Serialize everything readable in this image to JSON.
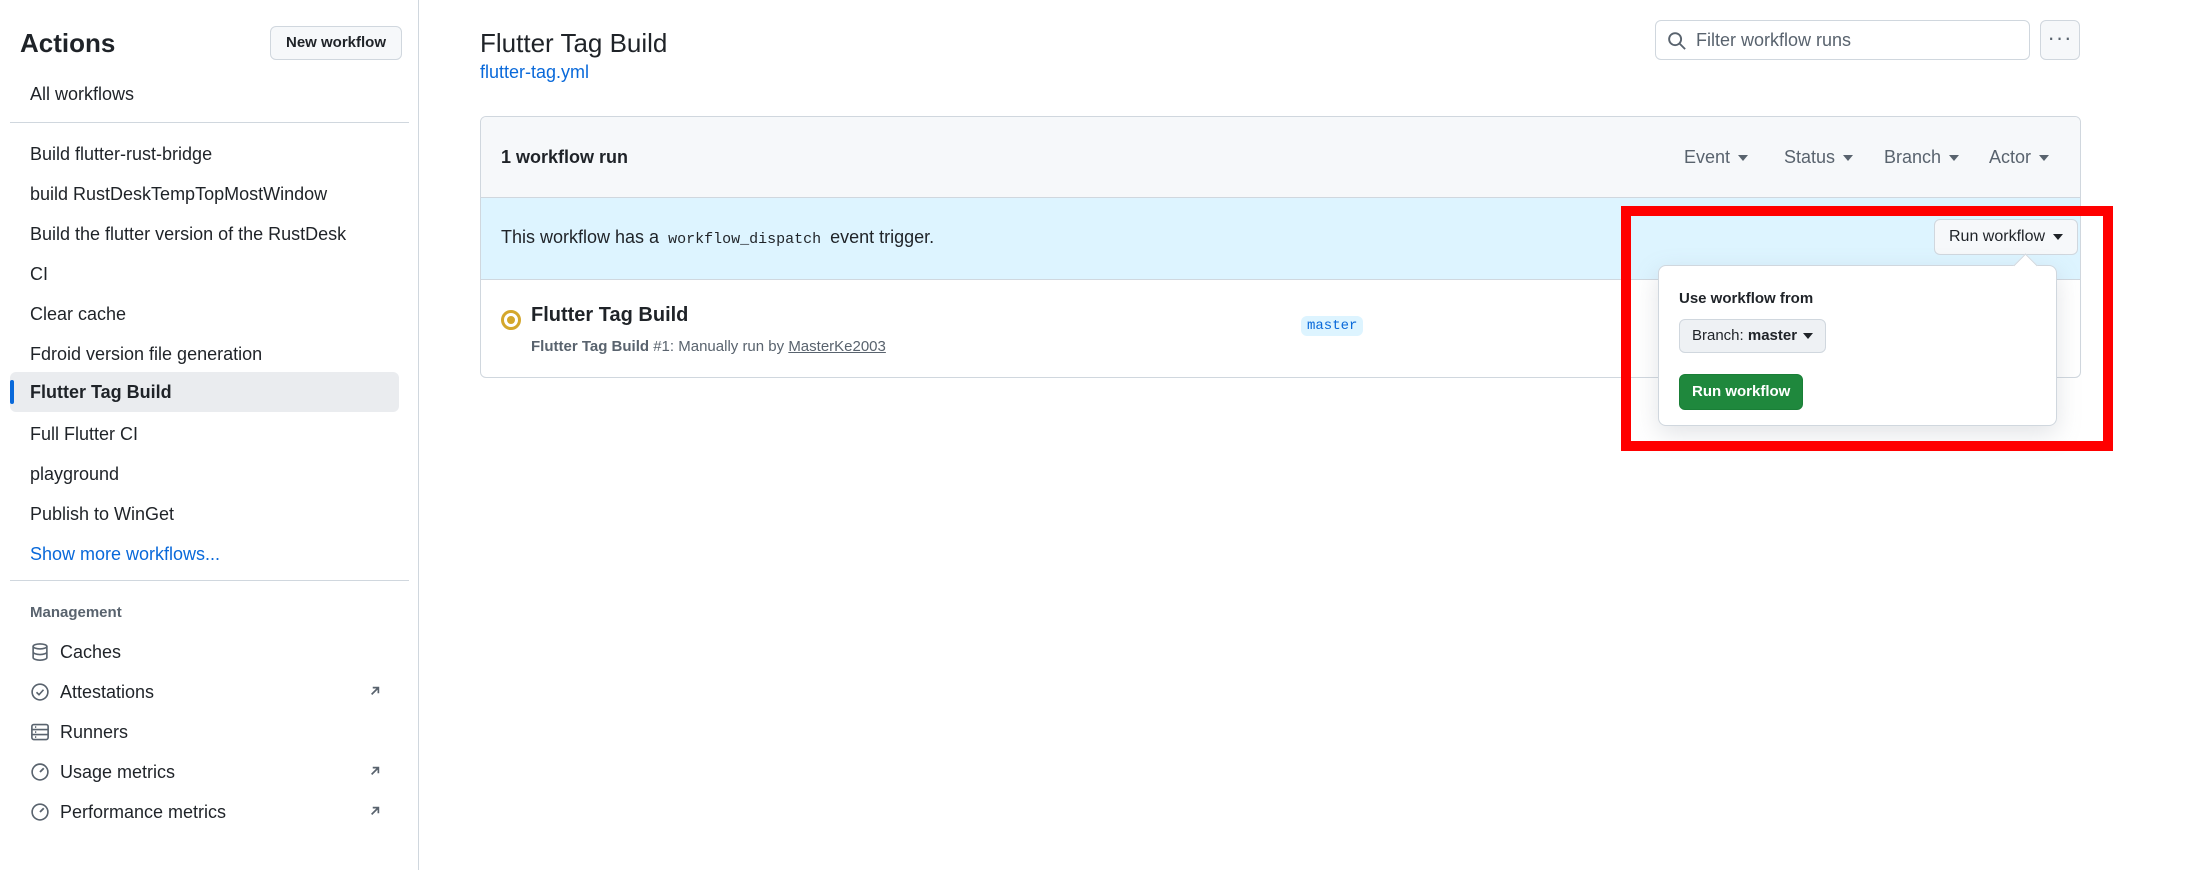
{
  "sidebar": {
    "title": "Actions",
    "new_workflow_label": "New workflow",
    "all_workflows": "All workflows",
    "workflows": [
      "Build flutter-rust-bridge",
      "build RustDeskTempTopMostWindow",
      "Build the flutter version of the RustDesk",
      "CI",
      "Clear cache",
      "Fdroid version file generation",
      "Flutter Tag Build",
      "Full Flutter CI",
      "playground",
      "Publish to WinGet"
    ],
    "active_workflow": "Flutter Tag Build",
    "show_more": "Show more workflows...",
    "management_heading": "Management",
    "management": [
      {
        "label": "Caches",
        "icon": "database-icon",
        "external": false
      },
      {
        "label": "Attestations",
        "icon": "verified-icon",
        "external": true
      },
      {
        "label": "Runners",
        "icon": "server-icon",
        "external": false
      },
      {
        "label": "Usage metrics",
        "icon": "meter-icon",
        "external": true
      },
      {
        "label": "Performance metrics",
        "icon": "meter-icon",
        "external": true
      }
    ]
  },
  "header": {
    "title": "Flutter Tag Build",
    "file_link": "flutter-tag.yml",
    "filter_placeholder": "Filter workflow runs"
  },
  "runs": {
    "count_label": "1 workflow run",
    "filters": [
      "Event",
      "Status",
      "Branch",
      "Actor"
    ],
    "dispatch_prefix": "This workflow has a",
    "dispatch_code": "workflow_dispatch",
    "dispatch_suffix": "event trigger.",
    "run_workflow_label": "Run workflow",
    "items": [
      {
        "title": "Flutter Tag Build",
        "meta_workflow": "Flutter Tag Build",
        "meta_number": "#1",
        "meta_text": ": Manually run by",
        "meta_user": "MasterKe2003",
        "branch": "master",
        "status": "queued"
      }
    ]
  },
  "popover": {
    "label": "Use workflow from",
    "branch_prefix": "Branch:",
    "branch_value": "master",
    "run_button": "Run workflow"
  },
  "colors": {
    "accent": "#0969da",
    "primary_button": "#1f883d",
    "highlight": "#ff0000",
    "dispatch_bg": "#ddf4ff",
    "status_queued": "#d4a72c"
  }
}
